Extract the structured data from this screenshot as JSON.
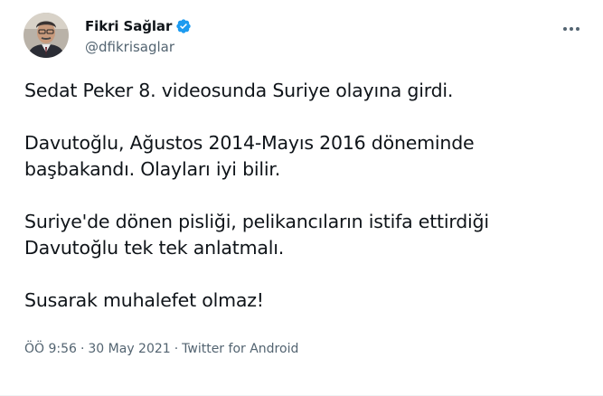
{
  "author": {
    "display_name": "Fikri Sağlar",
    "handle": "@dfikrisaglar",
    "verified": true
  },
  "tweet": {
    "paragraphs": [
      [
        "Sedat Peker 8. videosunda Suriye olayına girdi."
      ],
      [
        "Davutoğlu, Ağustos 2014-Mayıs 2016 döneminde",
        "başbakandı. Olayları iyi bilir."
      ],
      [
        "Suriye'de dönen pisliği, pelikancıların istifa ettirdiği",
        "Davutoğlu tek tek anlatmalı."
      ],
      [
        "Susarak muhalefet olmaz!"
      ]
    ]
  },
  "meta": {
    "time": "ÖÖ 9:56",
    "separator": "·",
    "date": "30 May 2021",
    "source": "Twitter for Android"
  },
  "icons": {
    "more": "more-horizontal-icon",
    "verified": "verified-badge-icon"
  },
  "colors": {
    "text": "#0f1419",
    "secondary": "#536471",
    "verified": "#1d9bf0"
  }
}
